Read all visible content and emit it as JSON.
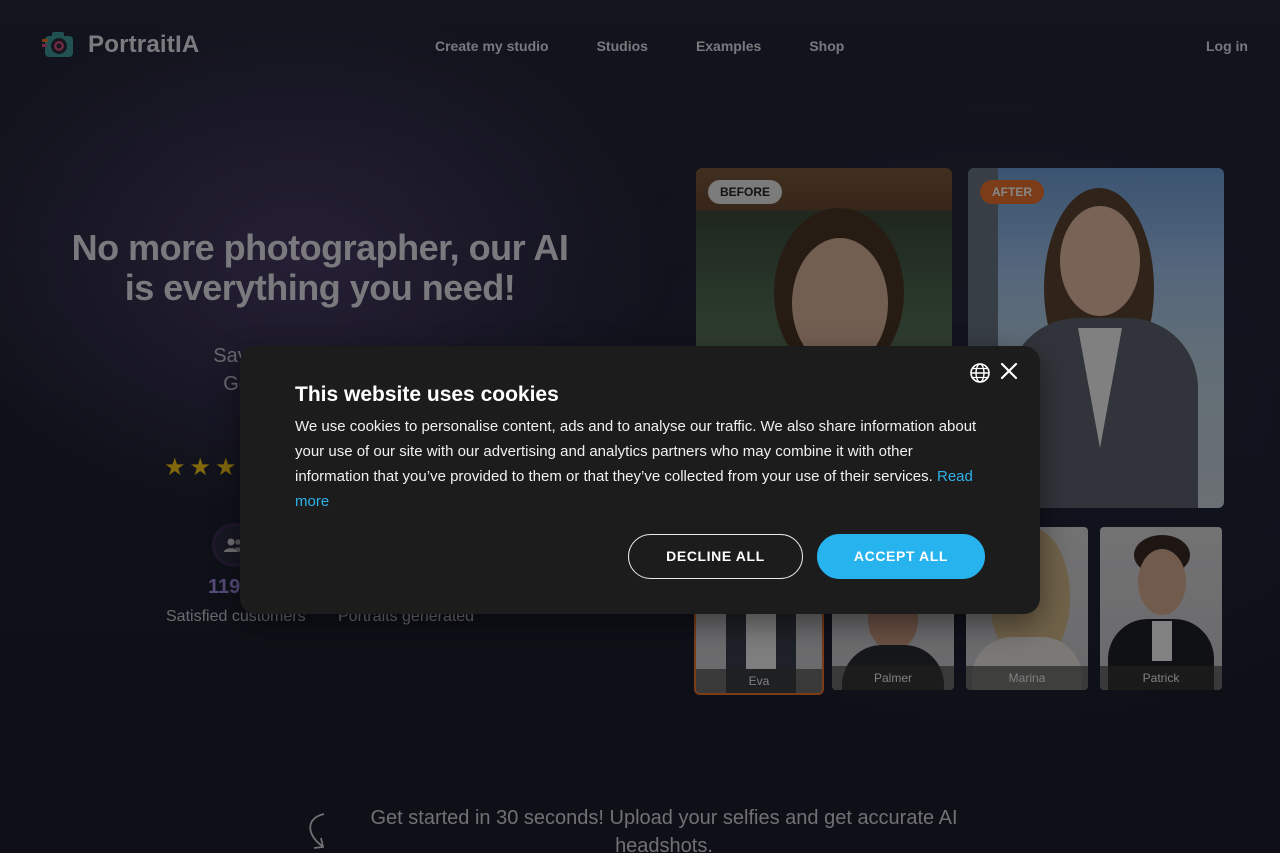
{
  "brand": {
    "name": "PortraitIA",
    "accent": "#e8712c",
    "purple": "#a58ee6",
    "link_blue": "#2fb2ea"
  },
  "nav": {
    "links": [
      "Create my studio",
      "Studios",
      "Examples",
      "Shop"
    ],
    "login": "Log in"
  },
  "hero": {
    "title": "No more photographer, our AI is everything you need!",
    "subtitle_line1": "Save time and money w",
    "subtitle_line2": "Get studio quality pho",
    "rating_stars": 3,
    "customers_count": "119",
    "customers_label": "Satisfied customers",
    "portraits_label": "Portraits generated"
  },
  "gallery": {
    "before_tag": "BEFORE",
    "after_tag": "AFTER",
    "thumbs": [
      "Eva",
      "Palmer",
      "Marina",
      "Patrick"
    ]
  },
  "bottom": {
    "get_started": "Get started in 30 seconds! Upload your selfies and get accurate AI headshots."
  },
  "cookie": {
    "title": "This website uses cookies",
    "body": "We use cookies to personalise content, ads and to analyse our traffic. We also share information about your use of our site with our advertising and analytics partners who may combine it with other information that you’ve provided to them or that they’ve collected from your use of their services.",
    "read_more": "Read more",
    "decline": "DECLINE ALL",
    "accept": "ACCEPT ALL"
  }
}
